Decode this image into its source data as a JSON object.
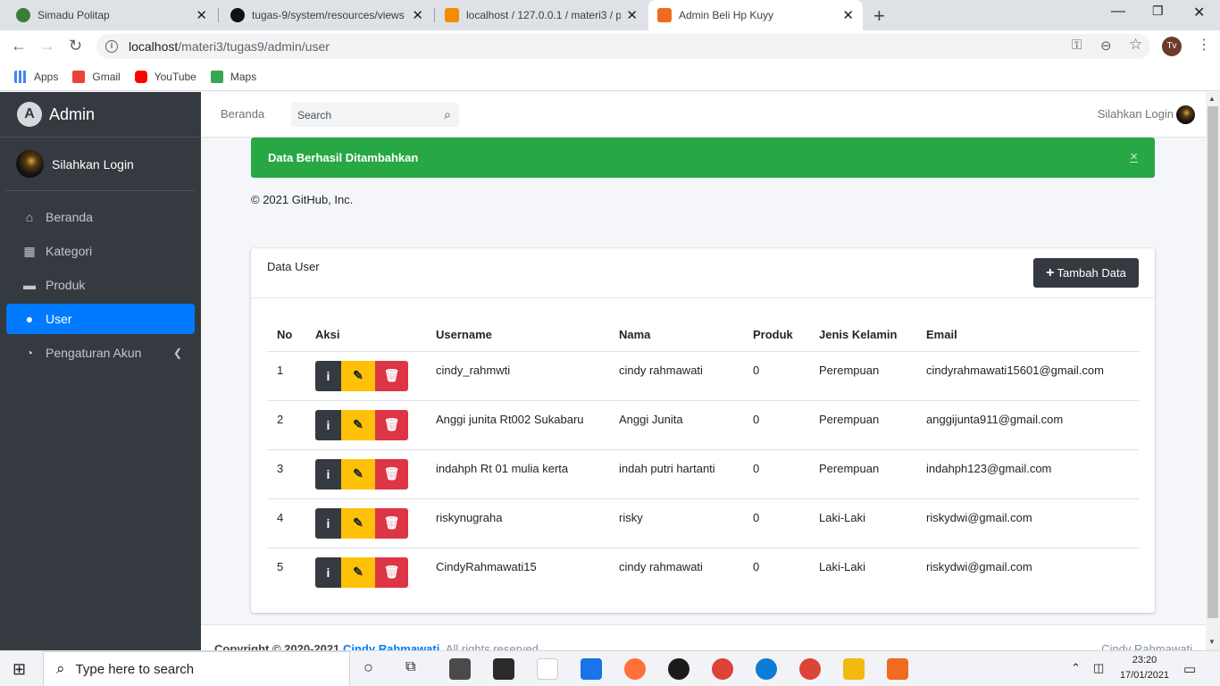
{
  "browser": {
    "tabs": [
      {
        "title": "Simadu Politap",
        "favicon_color": "#3a7d3a"
      },
      {
        "title": "tugas-9/system/resources/views",
        "favicon_color": "#111111"
      },
      {
        "title": "localhost / 127.0.0.1 / materi3 / p",
        "favicon_color": "#f28c00"
      },
      {
        "title": "Admin Beli Hp Kuyy",
        "favicon_color": "#f06b1f",
        "active": true
      }
    ],
    "url_host": "localhost",
    "url_path": "/materi3/tugas9/admin/user",
    "profile_initials": "Tv",
    "bookmarks": [
      {
        "label": "Apps",
        "icon": "apps-grid-icon",
        "color": "#4285f4"
      },
      {
        "label": "Gmail",
        "icon": "gmail-icon",
        "color": "#ea4335"
      },
      {
        "label": "YouTube",
        "icon": "youtube-icon",
        "color": "#ff0000"
      },
      {
        "label": "Maps",
        "icon": "maps-icon",
        "color": "#34a853"
      }
    ]
  },
  "sidebar": {
    "brand": "Admin",
    "brand_logo": "A",
    "user_name": "Silahkan Login",
    "items": [
      {
        "label": "Beranda",
        "icon": "home-icon"
      },
      {
        "label": "Kategori",
        "icon": "grid-icon"
      },
      {
        "label": "Produk",
        "icon": "box-icon"
      },
      {
        "label": "User",
        "icon": "user-icon",
        "active": true
      },
      {
        "label": "Pengaturan Akun",
        "icon": "gauge-icon",
        "has_arrow": true
      }
    ]
  },
  "topnav": {
    "home": "Beranda",
    "search_placeholder": "Search",
    "login": "Silahkan Login"
  },
  "alert": {
    "message": "Data Berhasil Ditambahkan",
    "close": "×",
    "color": "#28a745"
  },
  "copyright_line": "© 2021 GitHub, Inc.",
  "card": {
    "title": "Data User",
    "add_button": "Tambah Data",
    "columns": [
      "No",
      "Aksi",
      "Username",
      "Nama",
      "Produk",
      "Jenis Kelamin",
      "Email"
    ],
    "rows": [
      {
        "no": "1",
        "username": "cindy_rahmwti",
        "nama": "cindy rahmawati",
        "produk": "0",
        "jk": "Perempuan",
        "email": "cindyrahmawati15601@gmail.com"
      },
      {
        "no": "2",
        "username": "Anggi junita Rt002 Sukabaru",
        "nama": "Anggi Junita",
        "produk": "0",
        "jk": "Perempuan",
        "email": "anggijunta911@gmail.com"
      },
      {
        "no": "3",
        "username": "indahph Rt 01 mulia kerta",
        "nama": "indah putri hartanti",
        "produk": "0",
        "jk": "Perempuan",
        "email": "indahph123@gmail.com"
      },
      {
        "no": "4",
        "username": "riskynugraha",
        "nama": "risky",
        "produk": "0",
        "jk": "Laki-Laki",
        "email": "riskydwi@gmail.com"
      },
      {
        "no": "5",
        "username": "CindyRahmawati15",
        "nama": "cindy rahmawati",
        "produk": "0",
        "jk": "Laki-Laki",
        "email": "riskydwi@gmail.com"
      }
    ],
    "action_colors": {
      "info": "#343a40",
      "edit": "#ffc107",
      "delete": "#dc3545"
    }
  },
  "footer": {
    "prefix": "Copyright © 2020-2021",
    "author": "Cindy Rahmawati",
    "suffix": ". All rights reserved.",
    "right": "Cindy Rahmawati"
  },
  "taskbar": {
    "search_placeholder": "Type here to search",
    "time": "23:20",
    "date": "17/01/2021"
  }
}
